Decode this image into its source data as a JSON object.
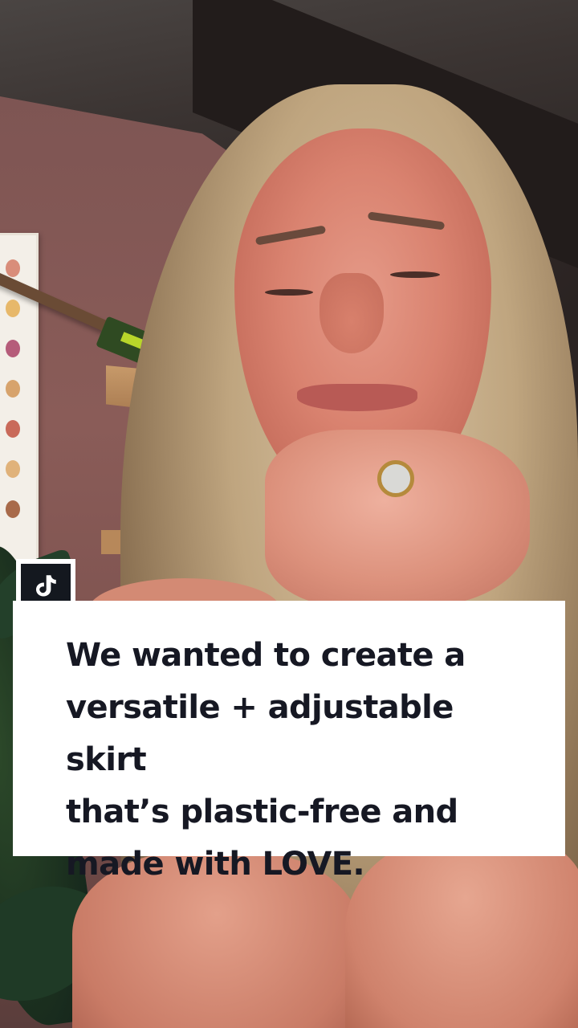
{
  "video": {
    "description_hidden": "",
    "caption": "We wanted to create a\nversatile + adjustable skirt\nthat’s plastic-free and\nmade with LOVE."
  },
  "overlay": {
    "logo_icon": "tiktok-logo-icon"
  },
  "colors": {
    "caption_bg": "#ffffff",
    "caption_text": "#161823",
    "logo_bg": "#14181f"
  }
}
